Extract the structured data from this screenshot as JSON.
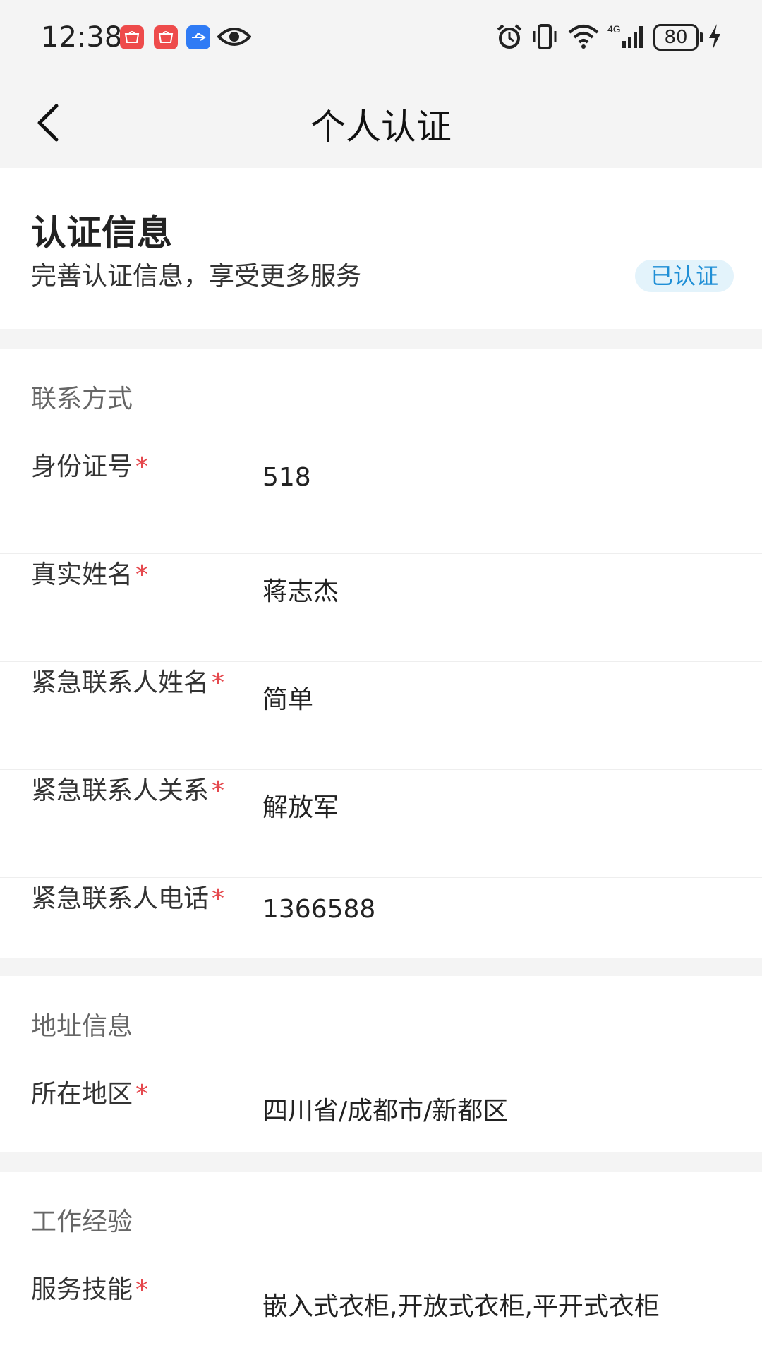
{
  "status_bar": {
    "time": "12:38",
    "battery": "80",
    "network": "4G"
  },
  "nav": {
    "title": "个人认证"
  },
  "hero": {
    "title": "认证信息",
    "subtitle": "完善认证信息，享受更多服务",
    "badge": "已认证"
  },
  "contact": {
    "section_title": "联系方式",
    "fields": [
      {
        "label": "身份证号",
        "value": "518"
      },
      {
        "label": "真实姓名",
        "value": "蒋志杰"
      },
      {
        "label": "紧急联系人姓名",
        "value": "简单"
      },
      {
        "label": "紧急联系人关系",
        "value": "解放军"
      },
      {
        "label": "紧急联系人电话",
        "value": "1366588"
      }
    ]
  },
  "address": {
    "section_title": "地址信息",
    "fields": [
      {
        "label": "所在地区",
        "value": "四川省/成都市/新都区"
      }
    ]
  },
  "work": {
    "section_title": "工作经验",
    "fields": [
      {
        "label": "服务技能",
        "value": "嵌入式衣柜,开放式衣柜,平开式衣柜"
      }
    ]
  },
  "required_mark": "*",
  "colors": {
    "accent": "#1f8fd6",
    "badge_bg": "#e3f3fb",
    "required": "#e5484d",
    "page_bg": "#f4f4f4"
  }
}
